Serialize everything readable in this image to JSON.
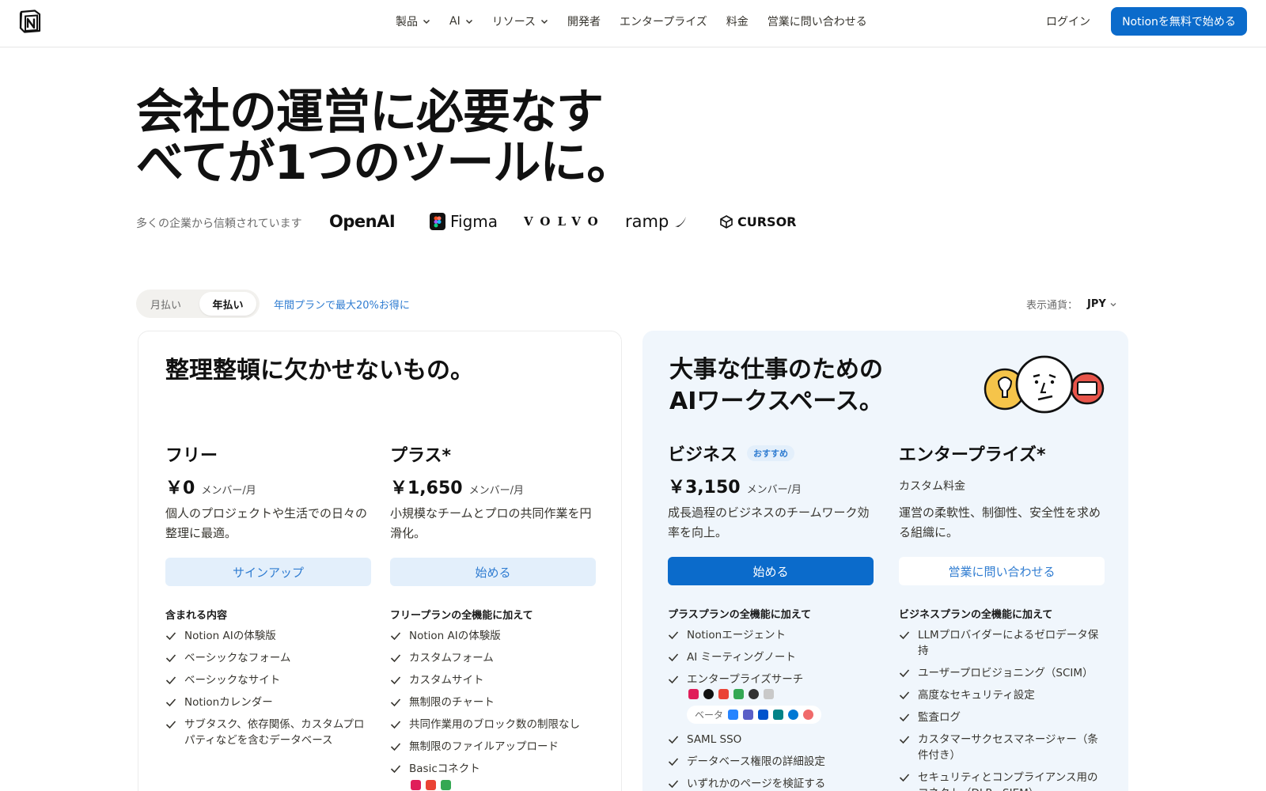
{
  "nav": {
    "items": [
      {
        "label": "製品",
        "has_dropdown": true
      },
      {
        "label": "AI",
        "has_dropdown": true
      },
      {
        "label": "リソース",
        "has_dropdown": true
      },
      {
        "label": "開発者",
        "has_dropdown": false
      },
      {
        "label": "エンタープライズ",
        "has_dropdown": false
      },
      {
        "label": "料金",
        "has_dropdown": false
      },
      {
        "label": "営業に問い合わせる",
        "has_dropdown": false
      }
    ],
    "login": "ログイン",
    "cta": "Notionを無料で始める"
  },
  "hero": {
    "line1": "会社の運営に必要なす",
    "line2": "べてが1つのツールに。"
  },
  "trusted": {
    "label": "多くの企業から信頼されています",
    "brands": [
      "OpenAI",
      "Figma",
      "VOLVO",
      "ramp",
      "CURSOR"
    ]
  },
  "billing": {
    "monthly": "月払い",
    "yearly": "年払い",
    "selected": "年払い",
    "promo": "年間プランで最大20%お得に",
    "currency_label": "表示通貨：",
    "currency_value": "JPY"
  },
  "colors": {
    "primary": "#0b6bcb",
    "link": "#2f7cd1",
    "card_tint": "#f0f6fc"
  },
  "cards": [
    {
      "title": "整理整頓に欠かせないもの。",
      "plans": [
        {
          "name": "フリー",
          "price": "￥0",
          "per": "メンバー/月",
          "desc": "個人のプロジェクトや生活での日々の整理に最適。",
          "button": "サインアップ",
          "features_title": "含まれる内容",
          "features": [
            "Notion AIの体験版",
            "ベーシックなフォーム",
            "ベーシックなサイト",
            "Notionカレンダー",
            "サブタスク、依存関係、カスタムプロパティなどを含むデータベース"
          ]
        },
        {
          "name": "プラス*",
          "price": "￥1,650",
          "per": "メンバー/月",
          "desc": "小規模なチームとプロの共同作業を円滑化。",
          "button": "始める",
          "features_title": "フリープランの全機能に加えて",
          "features": [
            "Notion AIの体験版",
            "カスタムフォーム",
            "カスタムサイト",
            "無制限のチャート",
            "共同作業用のブロック数の制限なし",
            "無制限のファイルアップロード",
            "Basicコネクト"
          ]
        }
      ]
    },
    {
      "title_line1": "大事な仕事のための",
      "title_line2": "AIワークスペース。",
      "plans": [
        {
          "name": "ビジネス",
          "badge": "おすすめ",
          "price": "￥3,150",
          "per": "メンバー/月",
          "desc": "成長過程のビジネスのチームワーク効率を向上。",
          "button": "始める",
          "features_title": "プラスプランの全機能に加えて",
          "features": [
            "Notionエージェント",
            "AI ミーティングノート",
            "エンタープライズサーチ",
            "SAML SSO",
            "データベース権限の詳細設定",
            "いずれかのページを検証する"
          ],
          "beta_label": "ベータ"
        },
        {
          "name": "エンタープライズ*",
          "custom_price": "カスタム料金",
          "desc": "運営の柔軟性、制御性、安全性を求める組織に。",
          "button": "営業に問い合わせる",
          "features_title": "ビジネスプランの全機能に加えて",
          "features": [
            "LLMプロバイダーによるゼロデータ保持",
            "ユーザープロビジョニング（SCIM）",
            "高度なセキュリティ設定",
            "監査ログ",
            "カスタマーサクセスマネージャー（条件付き）",
            "セキュリティとコンプライアンス用のコネクト（DLP、SIEM）"
          ]
        }
      ]
    }
  ]
}
